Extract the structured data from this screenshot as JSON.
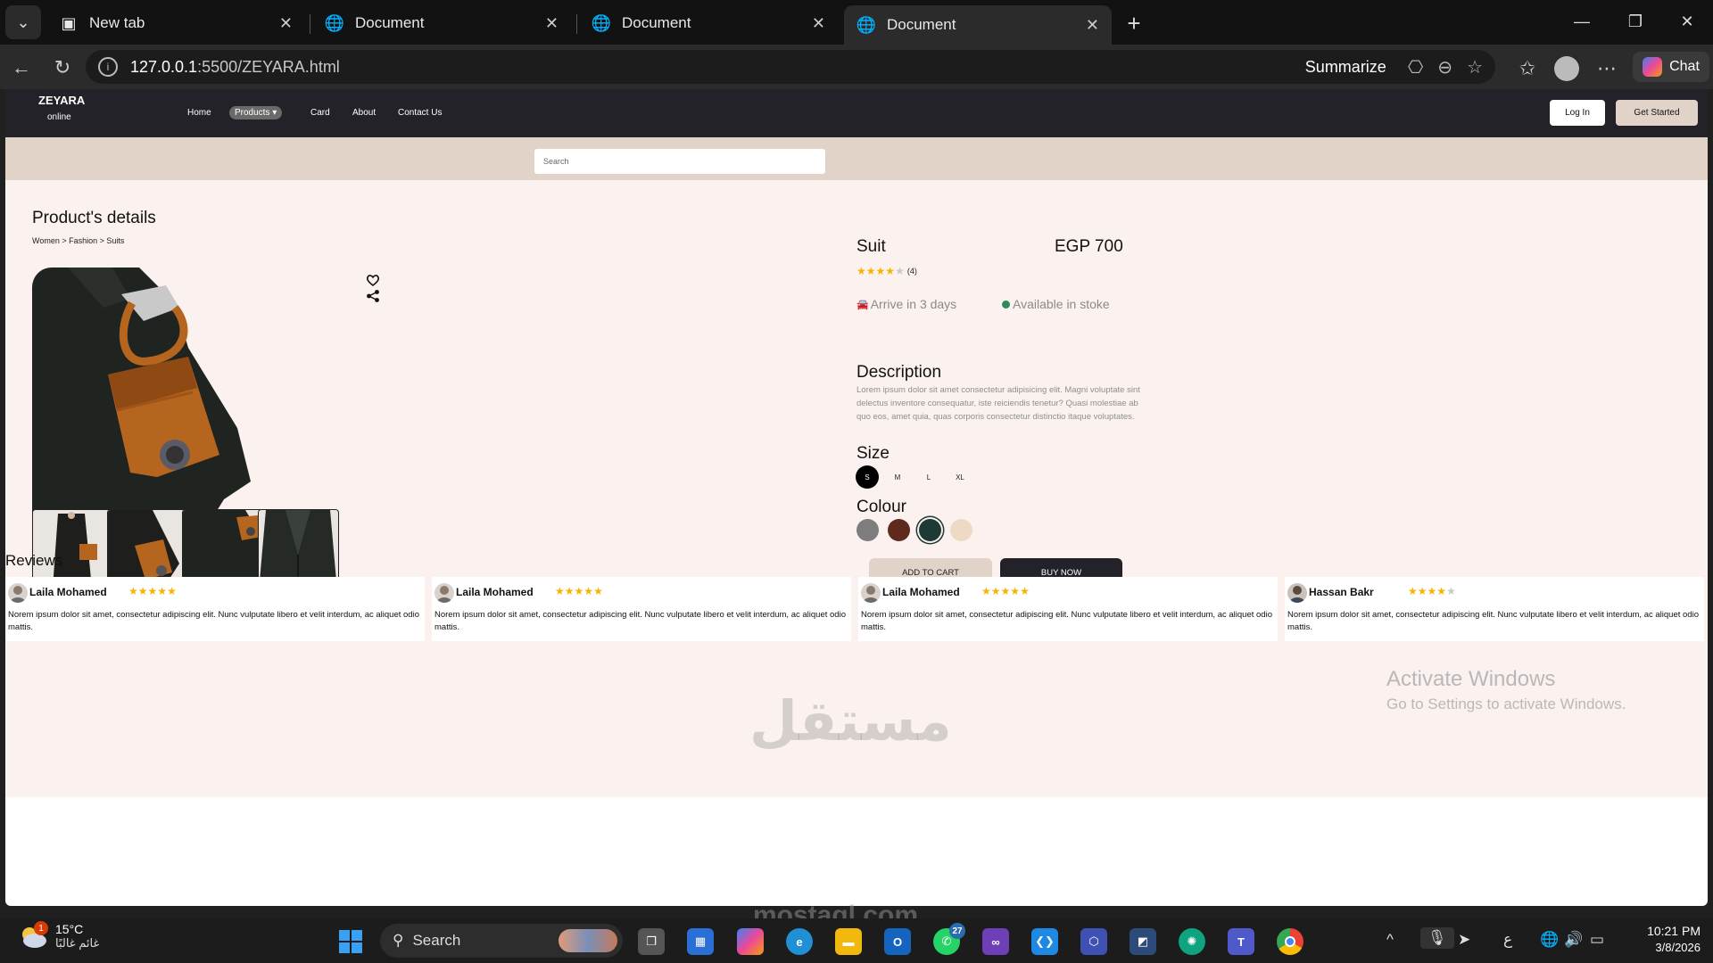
{
  "browser": {
    "tabs": [
      {
        "label": "New tab",
        "icon": "new-tab-page-icon",
        "active": false
      },
      {
        "label": "Document",
        "icon": "globe-icon",
        "active": false
      },
      {
        "label": "Document",
        "icon": "globe-icon",
        "active": false
      },
      {
        "label": "Document",
        "icon": "globe-icon",
        "active": true
      }
    ],
    "url_host": "127.0.0.1",
    "url_path": ":5500/ZEYARA.html",
    "summarize_label": "Summarize",
    "chat_label": "Chat"
  },
  "site": {
    "logo_title": "ZEYARA",
    "logo_sub": "online",
    "nav": [
      "Home",
      "Products",
      "Card",
      "About",
      "Contact Us"
    ],
    "active_nav": "Products",
    "login_label": "Log In",
    "get_started_label": "Get Started",
    "search_placeholder": "Search"
  },
  "product": {
    "page_title": "Product's details",
    "breadcrumb": "Women > Fashion > Suits",
    "name": "Suit",
    "price": "EGP 700",
    "rating": 4,
    "rating_max": 5,
    "rating_count": "(4)",
    "delivery": "Arrive in 3 days",
    "stock": "Available in stoke",
    "description_heading": "Description",
    "description": "Lorem ipsum dolor sit amet consectetur adipisicing elit. Magni voluptate sint delectus inventore consequatur, iste reiciendis tenetur? Quasi molestiae ab quo eos, amet quia, quas corporis consectetur distinctio itaque voluptates.",
    "size_heading": "Size",
    "sizes": [
      "S",
      "M",
      "L",
      "XL"
    ],
    "selected_size": "S",
    "colour_heading": "Colour",
    "colours": [
      "#7d7d7d",
      "#5e2a1e",
      "#1e3a34",
      "#eed9c4"
    ],
    "selected_colour": "#1e3a34",
    "add_to_cart_label": "ADD TO CART",
    "buy_now_label": "BUY NOW"
  },
  "reviews": {
    "heading": "Reviews",
    "items": [
      {
        "name": "Laila Mohamed",
        "rating": 5,
        "text": "Norem ipsum dolor sit amet, consectetur adipiscing elit. Nunc vulputate libero et velit interdum, ac aliquet odio mattis."
      },
      {
        "name": "Laila Mohamed",
        "rating": 5,
        "text": "Norem ipsum dolor sit amet, consectetur adipiscing elit. Nunc vulputate libero et velit interdum, ac aliquet odio mattis."
      },
      {
        "name": "Laila Mohamed",
        "rating": 5,
        "text": "Norem ipsum dolor sit amet, consectetur adipiscing elit. Nunc vulputate libero et velit interdum, ac aliquet odio mattis."
      },
      {
        "name": "Hassan Bakr",
        "rating": 4,
        "text": "Norem ipsum dolor sit amet, consectetur adipiscing elit. Nunc vulputate libero et velit interdum, ac aliquet odio mattis."
      }
    ]
  },
  "overlay": {
    "activate_title": "Activate Windows",
    "activate_sub": "Go to Settings to activate Windows.",
    "watermark": "مستقل",
    "watermark_sub": "mostaql.com"
  },
  "taskbar": {
    "weather_badge": "1",
    "temperature": "15°C",
    "condition": "غائم غالبًا",
    "search_label": "Search",
    "whatsapp_badge": "27",
    "input_lang": "ع",
    "time": "10:21 PM",
    "date": "3/8/2026"
  }
}
